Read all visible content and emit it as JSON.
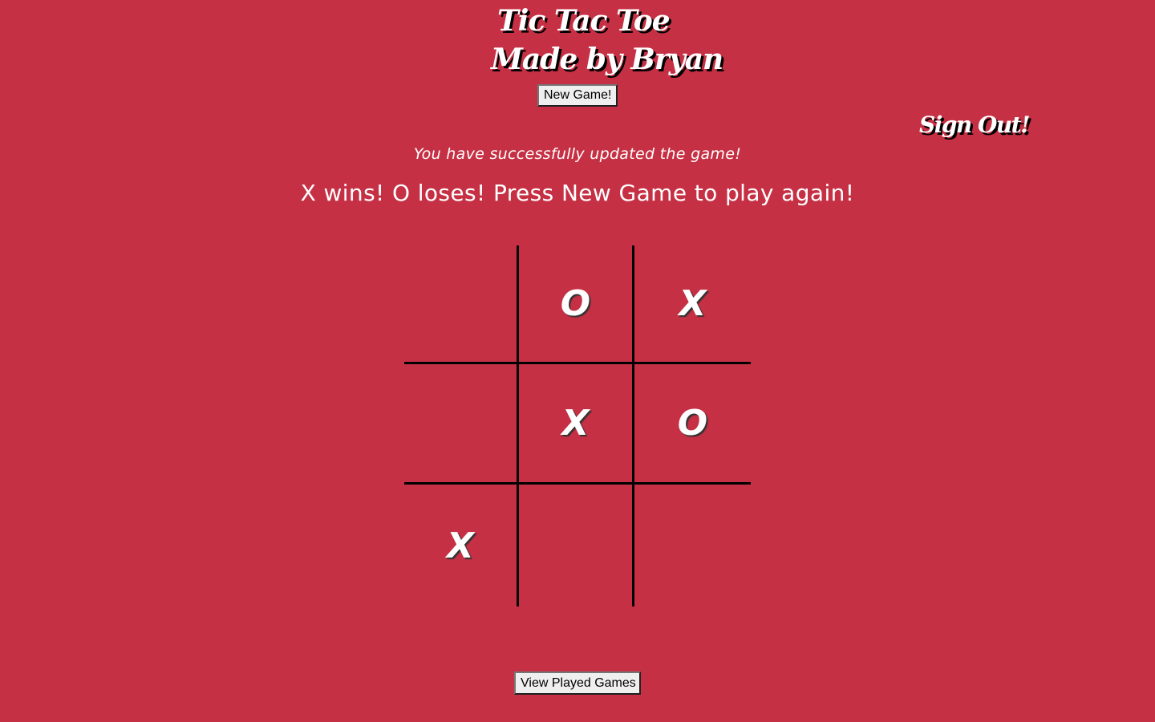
{
  "header": {
    "title_line1": "Tic Tac Toe",
    "title_line2": "Made by Bryan",
    "new_game_label": "New Game!",
    "sign_out_label": "Sign Out!"
  },
  "status": {
    "update_message": "You have successfully updated the game!",
    "result_message": "X wins! O loses! Press New Game to play again!"
  },
  "board": {
    "cells": [
      "",
      "O",
      "X",
      "",
      "X",
      "O",
      "X",
      "",
      ""
    ]
  },
  "footer": {
    "view_games_label": "View Played Games"
  },
  "colors": {
    "background": "#c63044",
    "text": "#ffffff",
    "grid_lines": "#000000"
  }
}
